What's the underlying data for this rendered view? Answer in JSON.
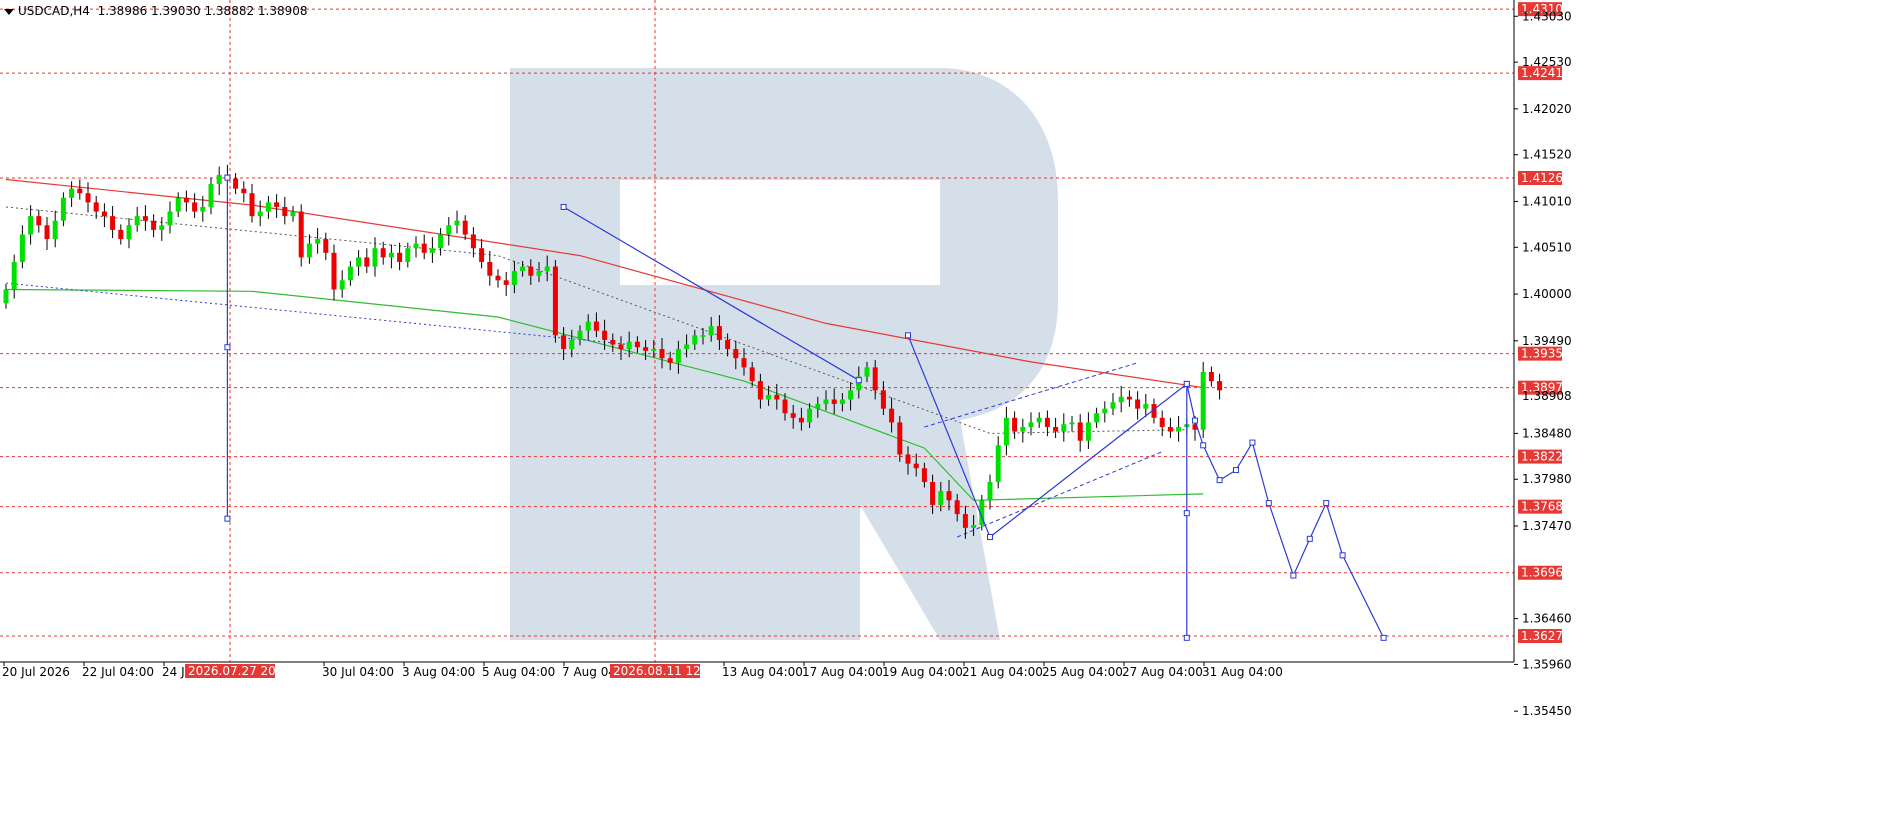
{
  "header": {
    "symbol": "USDCAD,H4",
    "ohlc": "1.38986 1.39030 1.38882 1.38908"
  },
  "colors": {
    "bull": "#00e000",
    "bear": "#ee0000",
    "ma_slow": "#e53935",
    "ma_fast": "#33bb33",
    "wave": "#2b3bd6",
    "level": "#e53935",
    "watermark": "#d5dfea"
  },
  "chart_data": {
    "type": "candlestick",
    "symbol": "USDCAD",
    "timeframe": "H4",
    "y_range": [
      1.351,
      1.434
    ],
    "y_ticks": [
      "1.43030",
      "1.42530",
      "1.42020",
      "1.41520",
      "1.41010",
      "1.40510",
      "1.40000",
      "1.39490",
      "1.38480",
      "1.37980",
      "1.37470",
      "1.36460",
      "1.35960",
      "1.35450"
    ],
    "level_tags": [
      {
        "label": "1.43108",
        "value": 1.43108
      },
      {
        "label": "1.42410",
        "value": 1.4241
      },
      {
        "label": "1.41266",
        "value": 1.41266
      },
      {
        "label": "1.39350",
        "value": 1.3935
      },
      {
        "label": "1.38979",
        "value": 1.38979
      },
      {
        "label": "1.38227",
        "value": 1.38227
      },
      {
        "label": "1.37681",
        "value": 1.37681
      },
      {
        "label": "1.36960",
        "value": 1.3696
      },
      {
        "label": "1.36270",
        "value": 1.3627
      }
    ],
    "price_hidden_label": "1.38908",
    "x_labels": [
      "20 Jul 2026",
      "22 Jul 04:00",
      "24 Jul 04:00",
      "30 Jul 04:00",
      "3 Aug 04:00",
      "5 Aug 04:00",
      "7 Aug 04:00",
      "13 Aug 04:00",
      "17 Aug 04:00",
      "19 Aug 04:00",
      "21 Aug 04:00",
      "25 Aug 04:00",
      "27 Aug 04:00",
      "31 Aug 04:00"
    ],
    "crosshair_labels": [
      "2026.07.27 20:00",
      "2026.08.11 12:00"
    ],
    "closes": [
      1.4005,
      1.4035,
      1.4065,
      1.4085,
      1.4075,
      1.406,
      1.408,
      1.4105,
      1.4115,
      1.411,
      1.41,
      1.409,
      1.4085,
      1.407,
      1.406,
      1.4075,
      1.4085,
      1.408,
      1.407,
      1.4075,
      1.409,
      1.4105,
      1.41,
      1.409,
      1.4095,
      1.412,
      1.413,
      1.4126,
      1.4115,
      1.411,
      1.4085,
      1.409,
      1.41,
      1.4095,
      1.4085,
      1.409,
      1.404,
      1.4055,
      1.406,
      1.4045,
      1.4005,
      1.4015,
      1.403,
      1.404,
      1.403,
      1.405,
      1.404,
      1.4045,
      1.4035,
      1.405,
      1.4055,
      1.4045,
      1.405,
      1.4065,
      1.4075,
      1.408,
      1.4065,
      1.405,
      1.4035,
      1.402,
      1.4015,
      1.401,
      1.4025,
      1.403,
      1.402,
      1.4025,
      1.403,
      1.3955,
      1.394,
      1.395,
      1.396,
      1.397,
      1.396,
      1.395,
      1.3945,
      1.394,
      1.3948,
      1.3942,
      1.3938,
      1.394,
      1.393,
      1.3925,
      1.394,
      1.3945,
      1.3955,
      1.3955,
      1.3965,
      1.395,
      1.394,
      1.393,
      1.392,
      1.3905,
      1.3885,
      1.389,
      1.3885,
      1.387,
      1.3865,
      1.386,
      1.3875,
      1.388,
      1.3885,
      1.388,
      1.3885,
      1.3895,
      1.391,
      1.392,
      1.3895,
      1.3875,
      1.386,
      1.3825,
      1.3815,
      1.381,
      1.3795,
      1.377,
      1.3785,
      1.3775,
      1.376,
      1.3745,
      1.3748,
      1.3775,
      1.3795,
      1.3835,
      1.3865,
      1.385,
      1.3855,
      1.386,
      1.3865,
      1.3855,
      1.385,
      1.3858,
      1.386,
      1.384,
      1.386,
      1.387,
      1.3875,
      1.3882,
      1.3888,
      1.3885,
      1.3875,
      1.388,
      1.3865,
      1.3855,
      1.385,
      1.3855,
      1.3858,
      1.3852,
      1.3915,
      1.3905,
      1.3895
    ],
    "slow_ma": [
      [
        0,
        1.4125
      ],
      [
        30,
        1.4097
      ],
      [
        70,
        1.4042
      ],
      [
        100,
        1.3968
      ],
      [
        125,
        1.3926
      ],
      [
        146,
        1.3898
      ]
    ],
    "fast_ma": [
      [
        0,
        1.4005
      ],
      [
        30,
        1.4003
      ],
      [
        60,
        1.3975
      ],
      [
        90,
        1.3905
      ],
      [
        112,
        1.3832
      ],
      [
        118,
        1.3775
      ],
      [
        146,
        1.3782
      ]
    ],
    "wave_lines": [
      [
        [
          68,
          1.4095
        ],
        [
          104,
          1.3906
        ]
      ],
      [
        [
          110,
          1.3955
        ],
        [
          120,
          1.3735
        ],
        [
          144,
          1.3902
        ],
        [
          145,
          1.3862
        ],
        [
          146,
          1.3835
        ],
        [
          148,
          1.3797
        ],
        [
          150,
          1.3808
        ],
        [
          152,
          1.3838
        ],
        [
          154,
          1.3772
        ],
        [
          157,
          1.3693
        ],
        [
          159,
          1.3733
        ],
        [
          161,
          1.3772
        ],
        [
          163,
          1.3715
        ],
        [
          168,
          1.3625
        ]
      ]
    ],
    "wave_markers": [
      [
        68,
        1.4095
      ],
      [
        104,
        1.3906
      ],
      [
        110,
        1.3955
      ],
      [
        120,
        1.3735
      ],
      [
        144,
        1.3902
      ],
      [
        145,
        1.3862
      ],
      [
        146,
        1.3835
      ],
      [
        148,
        1.3797
      ],
      [
        150,
        1.3808
      ],
      [
        152,
        1.3838
      ],
      [
        154,
        1.3772
      ],
      [
        157,
        1.3693
      ],
      [
        159,
        1.3733
      ],
      [
        161,
        1.3772
      ],
      [
        163,
        1.3715
      ],
      [
        168,
        1.3625
      ]
    ],
    "blue_vertical_1": {
      "x_index": 27,
      "top": 1.4127,
      "mid": 1.3942,
      "bottom": 1.3755
    },
    "blue_vertical_2": {
      "x_index": 144,
      "top": 1.3902,
      "mid": 1.3761,
      "bottom": 1.3625
    },
    "dotted_trend": [
      [
        [
          0,
          1.4012
        ],
        [
          76,
          1.3945
        ]
      ],
      [
        [
          0,
          1.4095
        ],
        [
          60,
          1.4042
        ],
        [
          120,
          1.3848
        ],
        [
          144,
          1.3852
        ]
      ]
    ],
    "channel_upper": [
      [
        112,
        1.3855
      ],
      [
        138,
        1.3925
      ]
    ],
    "channel_lower": [
      [
        116,
        1.3735
      ],
      [
        141,
        1.3828
      ]
    ]
  }
}
